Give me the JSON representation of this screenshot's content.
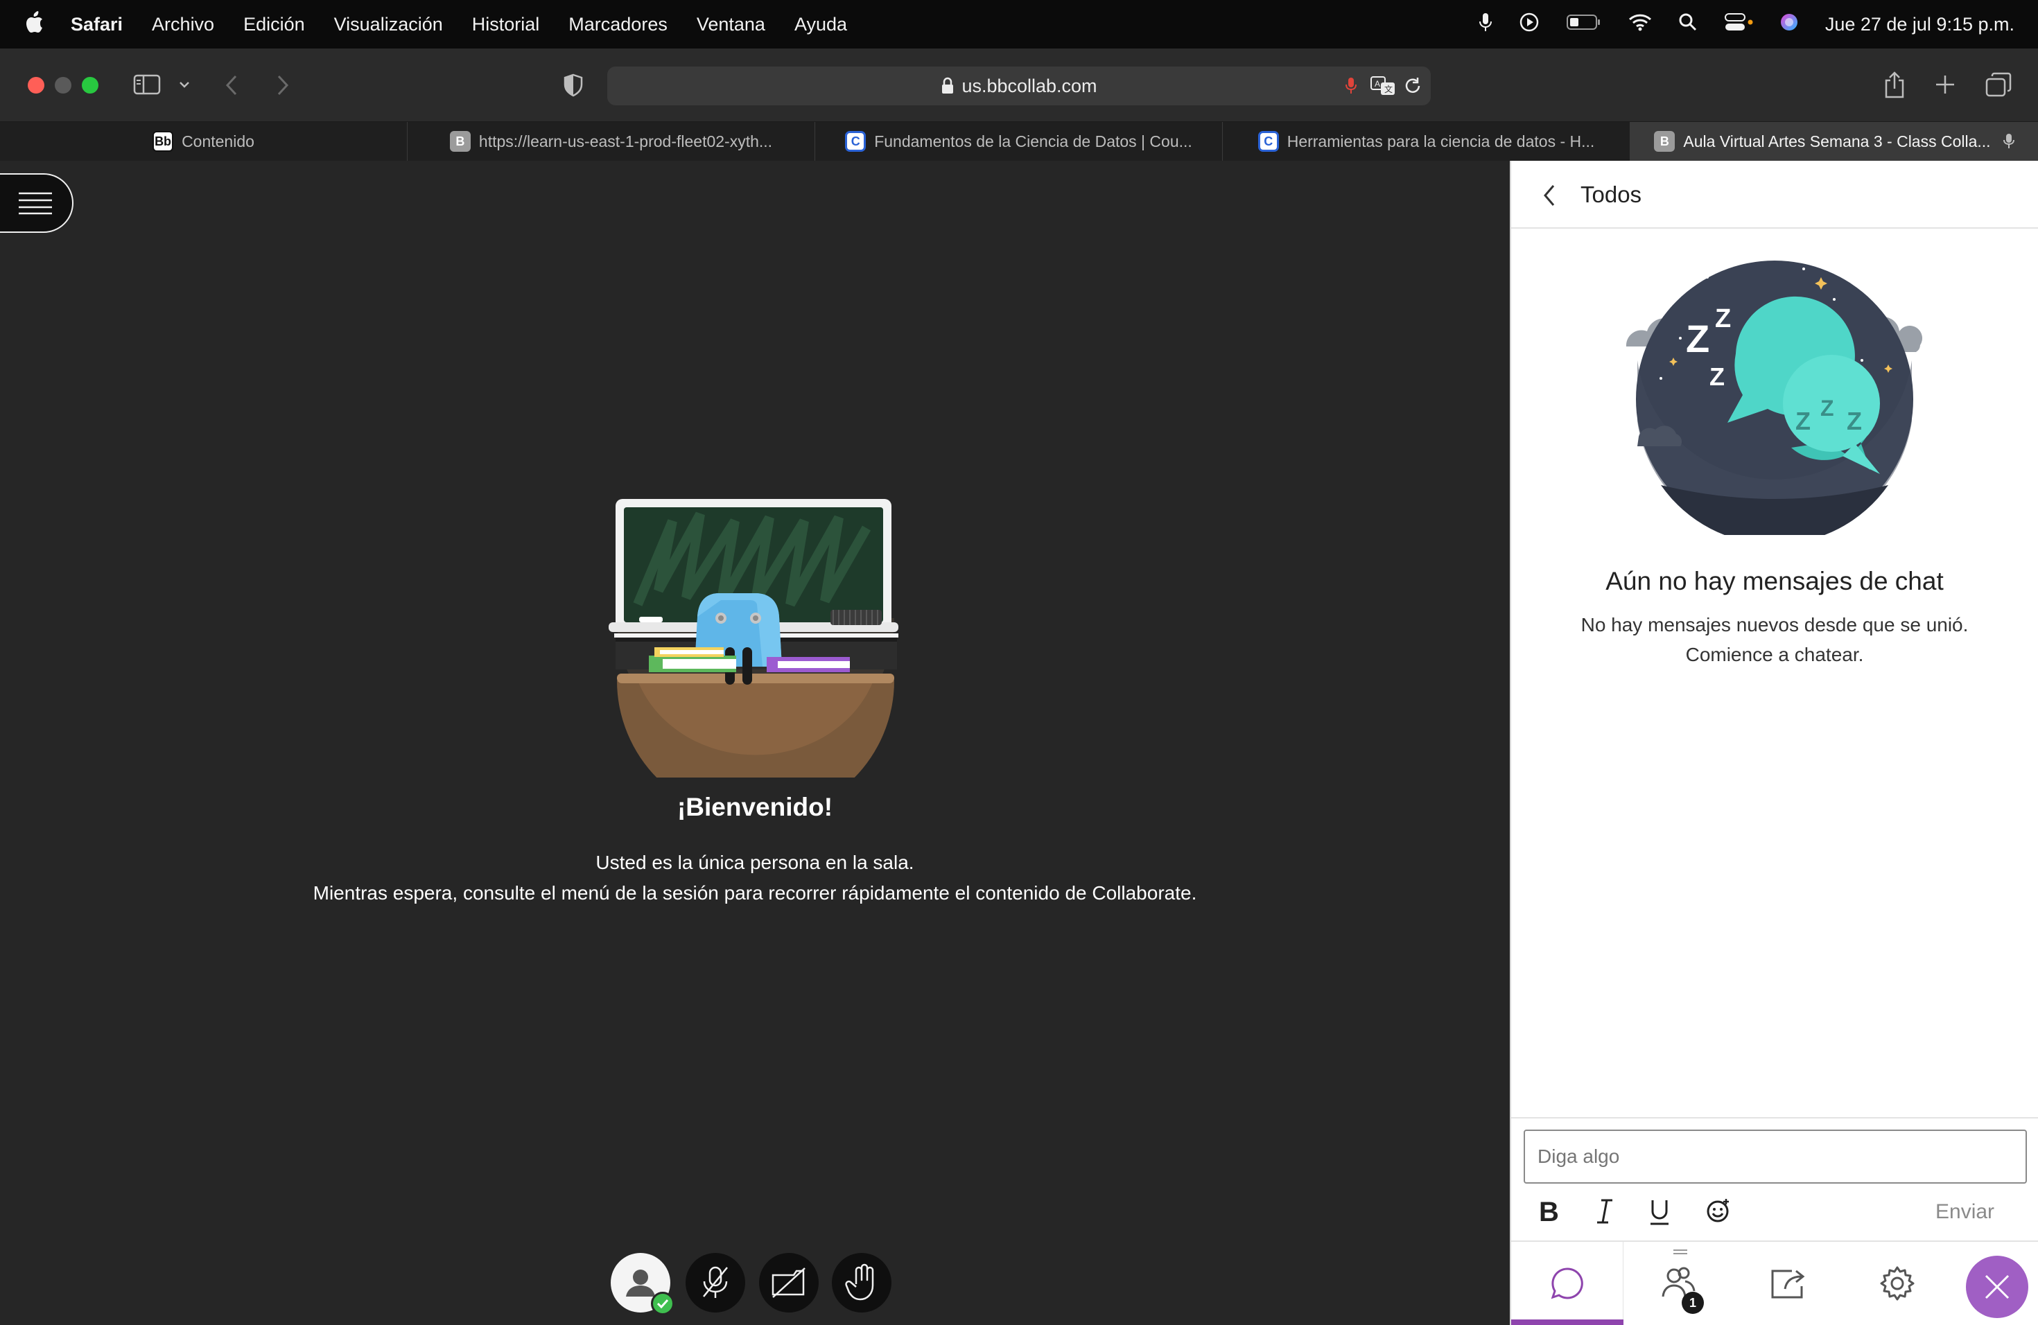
{
  "menubar": {
    "items": [
      "Safari",
      "Archivo",
      "Edición",
      "Visualización",
      "Historial",
      "Marcadores",
      "Ventana",
      "Ayuda"
    ],
    "datetime": "Jue 27 de jul  9:15 p.m."
  },
  "toolbar": {
    "url": "us.bbcollab.com"
  },
  "tabs": [
    {
      "label": "Contenido",
      "favicon": "Bb",
      "active": false
    },
    {
      "label": "https://learn-us-east-1-prod-fleet02-xyth...",
      "favicon": "B",
      "active": false
    },
    {
      "label": "Fundamentos de la Ciencia de Datos | Cou...",
      "favicon": "C",
      "active": false
    },
    {
      "label": "Herramientas para la ciencia de datos - H...",
      "favicon": "C",
      "active": false
    },
    {
      "label": "Aula Virtual Artes Semana 3 - Class Colla...",
      "favicon": "B",
      "active": true
    }
  ],
  "stage": {
    "welcome_title": "¡Bienvenido!",
    "welcome_line1": "Usted es la única persona en la sala.",
    "welcome_line2": "Mientras espera, consulte el menú de la sesión para recorrer rápidamente el contenido de Collaborate."
  },
  "chat_panel": {
    "header_title": "Todos",
    "empty_title": "Aún no hay mensajes de chat",
    "empty_line1": "No hay mensajes nuevos desde que se unió.",
    "empty_line2": "Comience a chatear.",
    "input_placeholder": "Diga algo",
    "send_label": "Enviar",
    "participants_count": "1"
  },
  "colors": {
    "accent_purple": "#8e44ad",
    "stage_bg": "#262626",
    "teal": "#4fd6c8"
  }
}
